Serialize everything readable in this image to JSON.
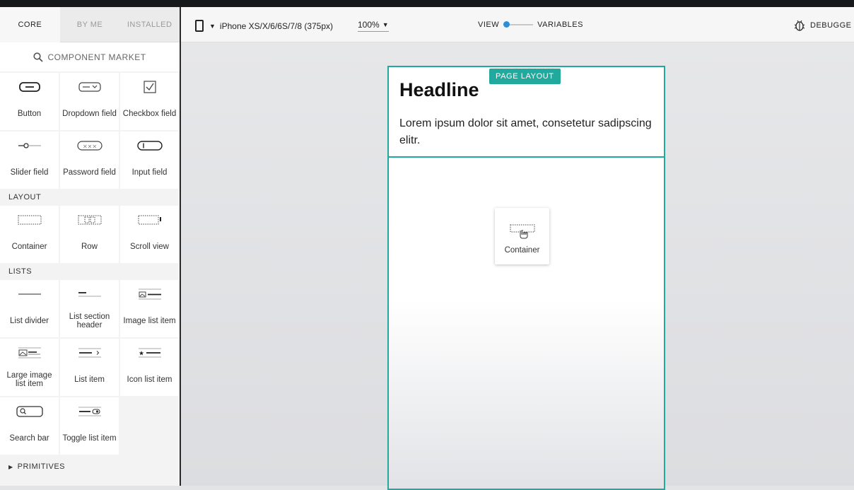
{
  "sidebar": {
    "tabs": [
      {
        "label": "CORE",
        "active": true
      },
      {
        "label": "BY ME",
        "active": false
      },
      {
        "label": "INSTALLED",
        "active": false
      }
    ],
    "market_label": "COMPONENT MARKET",
    "components": [
      {
        "label": "Button",
        "icon": "button-icon"
      },
      {
        "label": "Dropdown field",
        "icon": "dropdown-icon"
      },
      {
        "label": "Checkbox field",
        "icon": "checkbox-icon"
      },
      {
        "label": "Slider field",
        "icon": "slider-icon"
      },
      {
        "label": "Password field",
        "icon": "password-icon"
      },
      {
        "label": "Input field",
        "icon": "input-icon"
      }
    ],
    "layout_title": "LAYOUT",
    "layout": [
      {
        "label": "Container",
        "icon": "container-icon"
      },
      {
        "label": "Row",
        "icon": "row-icon"
      },
      {
        "label": "Scroll view",
        "icon": "scroll-view-icon"
      }
    ],
    "lists_title": "LISTS",
    "lists": [
      {
        "label": "List divider",
        "icon": "list-divider-icon"
      },
      {
        "label": "List section header",
        "icon": "list-section-header-icon"
      },
      {
        "label": "Image list item",
        "icon": "image-list-item-icon"
      },
      {
        "label": "Large image list item",
        "icon": "large-image-list-item-icon"
      },
      {
        "label": "List item",
        "icon": "list-item-icon"
      },
      {
        "label": "Icon list item",
        "icon": "icon-list-item-icon"
      },
      {
        "label": "Search bar",
        "icon": "search-bar-icon"
      },
      {
        "label": "Toggle list item",
        "icon": "toggle-list-item-icon"
      }
    ],
    "primitives_label": "PRIMITIVES"
  },
  "header": {
    "device": "iPhone XS/X/6/6S/7/8 (375px)",
    "zoom": "100%",
    "view_label": "VIEW",
    "variables_label": "VARIABLES",
    "debugger_label": "DEBUGGE"
  },
  "canvas": {
    "badge": "PAGE LAYOUT",
    "headline": "Headline",
    "body": "Lorem ipsum dolor sit amet, consetetur sadipscing elitr.",
    "drag_label": "Container"
  },
  "colors": {
    "accent": "#21a99d",
    "toggle": "#2b8fd9"
  }
}
